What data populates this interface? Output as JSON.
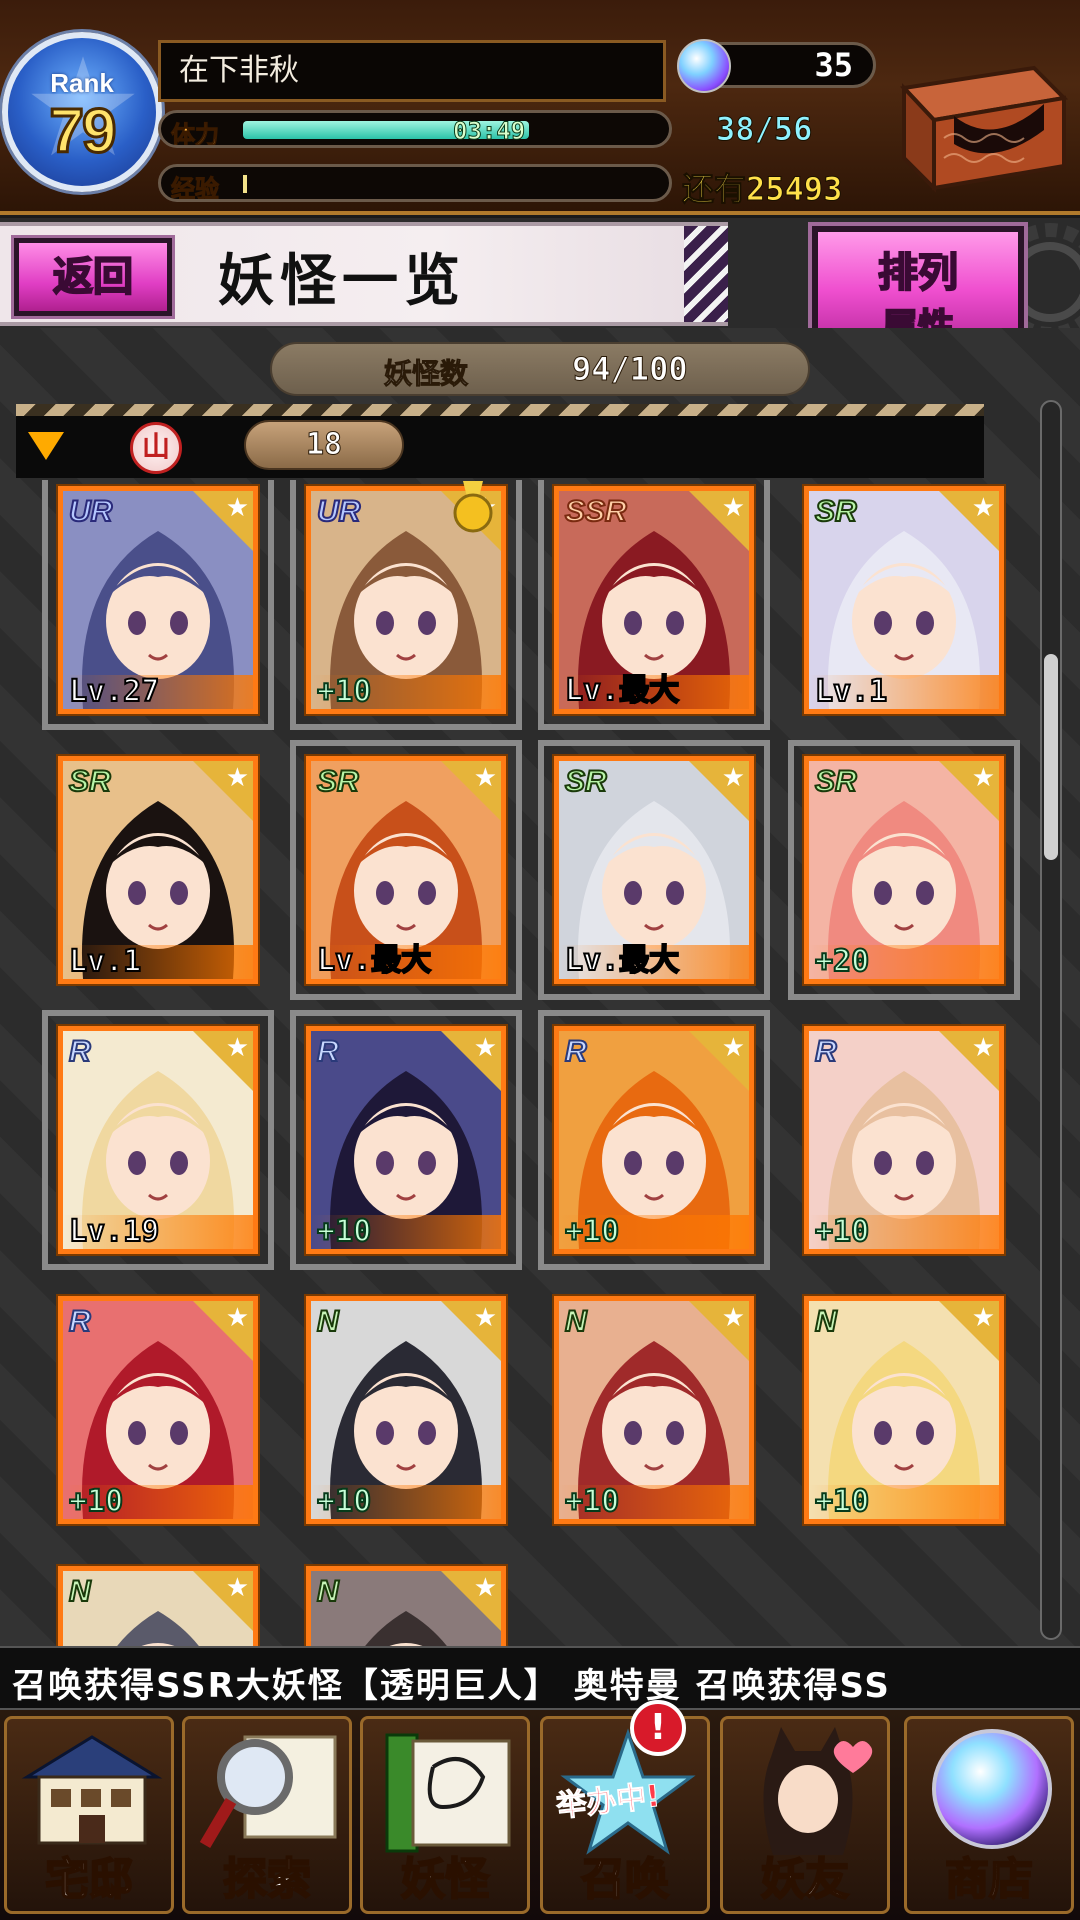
{
  "header": {
    "rank_label": "Rank",
    "rank_value": "79",
    "player_name": "在下非秋",
    "stamina_label": "体力",
    "stamina_timer": "03:49",
    "stamina_value": "38/56",
    "stamina_fraction": 0.68,
    "exp_label": "经验",
    "exp_remaining": "还有25493",
    "exp_fraction": 0.01,
    "gem_count": "35",
    "chest_icon": "treasure-chest-icon"
  },
  "title_row": {
    "back_label": "返回",
    "title": "妖怪一览",
    "sort_line1": "排列",
    "sort_line2": "属性"
  },
  "list": {
    "count_label": "妖怪数",
    "count_value": "94/100",
    "filter_emblem": "山",
    "filter_count": "18"
  },
  "cards": [
    {
      "rarity": "UR",
      "level": "Lv.27",
      "bg": "#8a8fc2",
      "hair": "#4a4f8a",
      "selected": true
    },
    {
      "rarity": "UR",
      "level": "+10",
      "bg": "#d8b48a",
      "hair": "#8a5a3a",
      "selected": true,
      "medal": true
    },
    {
      "rarity": "SSR",
      "level": "Lv.最大",
      "bg": "#c86a5a",
      "hair": "#8a1a22",
      "selected": true
    },
    {
      "rarity": "SR",
      "level": "Lv.1",
      "bg": "#d8d4ec",
      "hair": "#e8e8f4",
      "selected": false
    },
    {
      "rarity": "SR",
      "level": "Lv.1",
      "bg": "#e8c08a",
      "hair": "#1a1210",
      "selected": false
    },
    {
      "rarity": "SR",
      "level": "Lv.最大",
      "bg": "#f0a060",
      "hair": "#c8501a",
      "selected": true
    },
    {
      "rarity": "SR",
      "level": "Lv.最大",
      "bg": "#d0d4dc",
      "hair": "#e4e6ec",
      "selected": true
    },
    {
      "rarity": "SR",
      "level": "+20",
      "bg": "#f4b4a4",
      "hair": "#f08a80",
      "selected": true
    },
    {
      "rarity": "R",
      "level": "Lv.19",
      "bg": "#f4ead0",
      "hair": "#f0d8a0",
      "selected": true
    },
    {
      "rarity": "R",
      "level": "+10",
      "bg": "#4a4a8a",
      "hair": "#1e1838",
      "selected": true
    },
    {
      "rarity": "R",
      "level": "+10",
      "bg": "#f0a040",
      "hair": "#e86a10",
      "selected": true
    },
    {
      "rarity": "R",
      "level": "+10",
      "bg": "#f4d0c8",
      "hair": "#e8c0a0",
      "selected": false
    },
    {
      "rarity": "R",
      "level": "+10",
      "bg": "#e87070",
      "hair": "#b01a2a",
      "selected": false
    },
    {
      "rarity": "N",
      "level": "+10",
      "bg": "#d8d8d8",
      "hair": "#2a2a34",
      "selected": false
    },
    {
      "rarity": "N",
      "level": "+10",
      "bg": "#e8b090",
      "hair": "#a02a2a",
      "selected": false
    },
    {
      "rarity": "N",
      "level": "+10",
      "bg": "#f4e0b0",
      "hair": "#f4d880",
      "selected": false
    },
    {
      "rarity": "N",
      "level": "",
      "bg": "#e8d8b8",
      "hair": "#5a5a6a",
      "selected": false
    },
    {
      "rarity": "N",
      "level": "",
      "bg": "#8a7a7a",
      "hair": "#3a3030",
      "selected": false
    }
  ],
  "ticker": "A 召唤获得SSR大妖怪【透明巨人】   奥特曼 召唤获得SS",
  "nav": [
    {
      "label": "宅邸",
      "icon": "mansion-icon"
    },
    {
      "label": "探索",
      "icon": "magnifier-map-icon"
    },
    {
      "label": "妖怪",
      "icon": "scroll-icon"
    },
    {
      "label": "召唤",
      "icon": "summon-star-icon"
    },
    {
      "label": "妖友",
      "icon": "cat-girl-friend-icon"
    },
    {
      "label": "商店",
      "icon": "crystal-orb-icon"
    }
  ],
  "summon_badge": "!",
  "summon_event": "举办中!"
}
